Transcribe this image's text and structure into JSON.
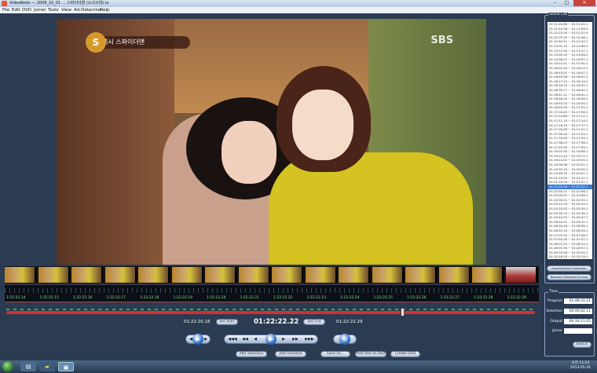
{
  "titlebar": {
    "title": "VideoRedo — 2009_10_01 ... 스파이더맨 (소녀시대).ts",
    "minimize": "–",
    "maximize": "□",
    "close": "✕"
  },
  "menu": [
    "File",
    "Edit",
    "DVD",
    "Joiner",
    "Tools",
    "View",
    "Ad-Detective",
    "Help"
  ],
  "video": {
    "caption": "섹시 스파이더맨",
    "caption_logo": "S",
    "watermark": "SBS"
  },
  "ruler_ticks": [
    "1:22:22.14",
    "1:22:22.15",
    "1:22:22.16",
    "1:22:22.17",
    "1:22:22.18",
    "1:22:22.19",
    "1:22:22.20",
    "1:22:22.21",
    "1:22:22.22",
    "1:22:22.23",
    "1:22:22.24",
    "1:22:22.25",
    "1:22:22.26",
    "1:22:22.27",
    "1:22:22.28",
    "1:22:22.29"
  ],
  "timecodes": {
    "start": "01:22:20.18",
    "current": "01:22:22.22",
    "end": "01:22:22.29"
  },
  "buttons": {
    "set_start": "Set Start",
    "set_end": "Set End",
    "add_selection": "Add Selection",
    "add_unselect": "Add Unselect",
    "save_as": "Save As...",
    "add_title": "Add title to DVD",
    "create_dvd": "Create DVD",
    "insert_selection": "Insert/Extend Selection",
    "remove_scenes": "Remove Selected Scenes",
    "switch": "Switch"
  },
  "transport": {
    "prev_label": "◀",
    "play_label": "▶",
    "next_label": "▶",
    "fast_back": "◀◀◀",
    "step_back": "◀◀",
    "frame_back": "◀",
    "play_center": "▶",
    "frame_fwd": "▶",
    "step_fwd": "▶▶",
    "fast_fwd": "▶▶▶",
    "loop_label": "↻"
  },
  "scene_list": {
    "header": "Scene List",
    "rows": [
      "01:11:40.80 ~ 01:11:45.1",
      "01:11:54.28 ~ 01:11:56.5",
      "01:12:22.00 ~ 01:12:22.0",
      "01:12:33.20 ~ 01:12:48.1",
      "01:12:40.11 ~ 01:12:47.1",
      "01:13:01.10 ~ 01:13:06.1",
      "01:13:12.20 ~ 01:13:17.1",
      "01:14:05.10 ~ 01:14:06.2",
      "01:14:56.21 ~ 01:14:57.1",
      "01:15:22.01 ~ 01:15:30.1",
      "01:16:22.20 ~ 01:16:23.1",
      "01:16:43.01 ~ 01:16:47.1",
      "01:16:49.26 ~ 01:16:51.2",
      "01:16:17.12 ~ 01:16:19.1",
      "01:16:29.15 ~ 01:16:32.1",
      "01:16:33.17 ~ 01:16:40.1",
      "01:16:41.21 ~ 01:16:41.1",
      "01:16:46.10 ~ 01:16:49.1",
      "01:16:53.20 ~ 01:16:55.1",
      "01:16:59.00 ~ 01:17:02.1",
      "01:17:04.20 ~ 01:17:06.1",
      "01:17:10.80 ~ 01:17:11.1",
      "01:17:11.10 ~ 01:17:14.1",
      "01:17:16.19 ~ 01:17:17.1",
      "01:17:20.09 ~ 01:17:21.1",
      "01:17:28.10 ~ 01:17:29.1",
      "01:17:33.00 ~ 01:17:34.1",
      "01:17:36.13 ~ 01:17:38.1",
      "01:17:53.00 ~ 01:17:55.1",
      "01:19:07.00 ~ 01:19:08.1",
      "01:19:13.10 ~ 01:19:17.1",
      "01:19:24.01 ~ 01:19:25.1",
      "01:19:30.06 ~ 01:19:31.1",
      "01:19:33.10 ~ 01:19:35.1",
      "01:19:46.20 ~ 01:20:01.1",
      "01:21:10.20 ~ 01:21:12.1",
      "01:21:55.20 ~ 01:21:57.1",
      "01:22:20.18 ~ 01:22:22.2",
      "01:22:50.11 ~ 01:22:56.1",
      "01:23:03.07 ~ 01:23:06.1",
      "01:24:30.21 ~ 01:24:32.1",
      "01:25:13.10 ~ 01:25:15.1",
      "01:25:33.02 ~ 01:25:35.1",
      "01:25:35.14 ~ 01:25:38.1",
      "01:25:44.25 ~ 01:25:47.1",
      "01:26:10.01 ~ 01:26:11.1",
      "01:26:34.26 ~ 01:26:36.1",
      "01:26:52.10 ~ 01:26:55.1",
      "01:27:07.02 ~ 01:27:08.1",
      "01:27:55.20 ~ 01:27:57.1",
      "01:28:07.02 ~ 01:28:12.1",
      "01:28:55.20 ~ 01:28:57.1",
      "01:29:33.28 ~ 01:29:35.1",
      "01:32:16.10 ~ 01:32:19.1"
    ],
    "selected_index": 37
  },
  "time_panel": {
    "header": "Time",
    "program_label": "Program",
    "program_value": "01:48:31.21",
    "selection_label": "Selection",
    "selection_value": "00:00:02.11",
    "output_label": "Output",
    "output_value": "00:16:11.05",
    "joiner_label": "Joiner",
    "joiner_value": ""
  },
  "taskbar": {
    "time": "오전 11:23",
    "date": "2013-05-31"
  },
  "colors": {
    "accent": "#3b79d6",
    "scrubber": "#d23030",
    "ruler_text": "#7cf07c"
  }
}
